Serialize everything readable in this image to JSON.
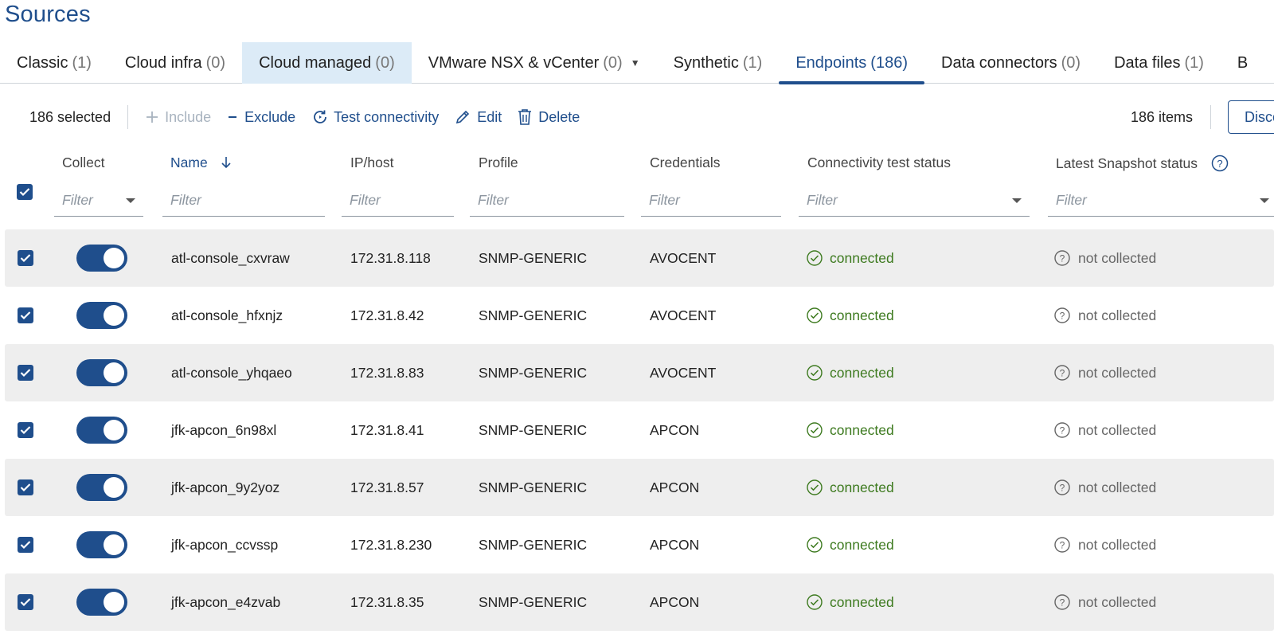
{
  "page": {
    "title": "Sources"
  },
  "tabs": [
    {
      "label": "Classic",
      "count": "(1)"
    },
    {
      "label": "Cloud infra",
      "count": "(0)"
    },
    {
      "label": "Cloud managed",
      "count": "(0)"
    },
    {
      "label": "VMware NSX & vCenter",
      "count": "(0)"
    },
    {
      "label": "Synthetic",
      "count": "(1)"
    },
    {
      "label": "Endpoints",
      "count": "(186)"
    },
    {
      "label": "Data connectors",
      "count": "(0)"
    },
    {
      "label": "Data files",
      "count": "(1)"
    },
    {
      "label": "B",
      "count": ""
    }
  ],
  "toolbar": {
    "selected": "186 selected",
    "include": "Include",
    "exclude": "Exclude",
    "test_connectivity": "Test connectivity",
    "edit": "Edit",
    "delete": "Delete",
    "items_count": "186 items",
    "discover": "Disco"
  },
  "columns": {
    "collect": "Collect",
    "name": "Name",
    "ip": "IP/host",
    "profile": "Profile",
    "credentials": "Credentials",
    "connectivity": "Connectivity test status",
    "snapshot": "Latest Snapshot status"
  },
  "filter_placeholder": "Filter",
  "rows": [
    {
      "name": "atl-console_cxvraw",
      "ip": "172.31.8.118",
      "profile": "SNMP-GENERIC",
      "credentials": "AVOCENT",
      "connectivity": "connected",
      "snapshot": "not collected"
    },
    {
      "name": "atl-console_hfxnjz",
      "ip": "172.31.8.42",
      "profile": "SNMP-GENERIC",
      "credentials": "AVOCENT",
      "connectivity": "connected",
      "snapshot": "not collected"
    },
    {
      "name": "atl-console_yhqaeo",
      "ip": "172.31.8.83",
      "profile": "SNMP-GENERIC",
      "credentials": "AVOCENT",
      "connectivity": "connected",
      "snapshot": "not collected"
    },
    {
      "name": "jfk-apcon_6n98xl",
      "ip": "172.31.8.41",
      "profile": "SNMP-GENERIC",
      "credentials": "APCON",
      "connectivity": "connected",
      "snapshot": "not collected"
    },
    {
      "name": "jfk-apcon_9y2yoz",
      "ip": "172.31.8.57",
      "profile": "SNMP-GENERIC",
      "credentials": "APCON",
      "connectivity": "connected",
      "snapshot": "not collected"
    },
    {
      "name": "jfk-apcon_ccvssp",
      "ip": "172.31.8.230",
      "profile": "SNMP-GENERIC",
      "credentials": "APCON",
      "connectivity": "connected",
      "snapshot": "not collected"
    },
    {
      "name": "jfk-apcon_e4zvab",
      "ip": "172.31.8.35",
      "profile": "SNMP-GENERIC",
      "credentials": "APCON",
      "connectivity": "connected",
      "snapshot": "not collected"
    }
  ],
  "colors": {
    "primary": "#1f4e8c",
    "success": "#3d7a1f",
    "tab_hover": "#dcebf7",
    "row_shade": "#eeeeee"
  }
}
